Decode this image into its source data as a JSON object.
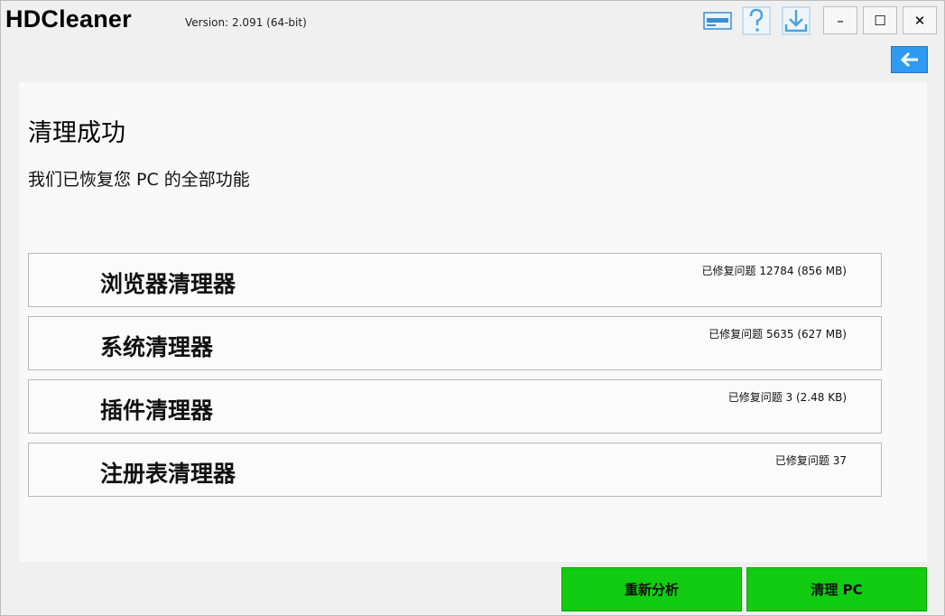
{
  "app": {
    "title": "HDCleaner",
    "version": "Version: 2.091 (64-bit)"
  },
  "toolbar": {
    "icons": [
      "license-icon",
      "help-icon",
      "download-icon"
    ]
  },
  "window_controls": {
    "minimize": "–",
    "maximize": "☐",
    "close": "✕"
  },
  "colors": {
    "accent_blue": "#2e9bf0",
    "action_green": "#11cc11"
  },
  "main": {
    "heading": "清理成功",
    "subheading": "我们已恢复您 PC 的全部功能",
    "cleaners": [
      {
        "name": "浏览器清理器",
        "stat": "已修复问题 12784 (856 MB)"
      },
      {
        "name": "系统清理器",
        "stat": "已修复问题 5635 (627 MB)"
      },
      {
        "name": "插件清理器",
        "stat": "已修复问题 3 (2.48 KB)"
      },
      {
        "name": "注册表清理器",
        "stat": "已修复问题 37"
      }
    ]
  },
  "actions": {
    "reanalyze": "重新分析",
    "clean_pc": "清理 PC"
  }
}
